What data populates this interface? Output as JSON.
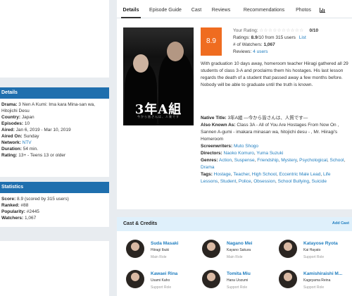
{
  "left": {
    "details": {
      "header": "Details",
      "rows": [
        {
          "label": "Drama:",
          "value": "3 Nen A Kumi: Ima kara Mina-san wa, Hitojichi Desu"
        },
        {
          "label": "Country:",
          "value": "Japan"
        },
        {
          "label": "Episodes:",
          "value": "10"
        },
        {
          "label": "Aired:",
          "value": "Jan 6, 2019 - Mar 10, 2019"
        },
        {
          "label": "Aired On:",
          "value": "Sunday"
        },
        {
          "label": "Network:",
          "value": "NTV"
        },
        {
          "label": "Duration:",
          "value": "54 min."
        },
        {
          "label": "Rating:",
          "value": "13+ - Teens 13 or older"
        }
      ]
    },
    "statistics": {
      "header": "Statistics",
      "rows": [
        {
          "label": "Score:",
          "value": "8.9 (scored by 315 users)"
        },
        {
          "label": "Ranked:",
          "value": "#88"
        },
        {
          "label": "Popularity:",
          "value": "#2445"
        },
        {
          "label": "Watchers:",
          "value": "1,067"
        }
      ]
    }
  },
  "tabs": [
    "Details",
    "Episode Guide",
    "Cast",
    "Reviews",
    "Recommendations",
    "Photos"
  ],
  "poster": {
    "title": "3年A組",
    "subtitle": "今から皆さんは、人質です"
  },
  "score_badge": "8.9",
  "rating": {
    "your_rating_label": "Your Rating:",
    "your_rating_value": "0/10",
    "ratings_label": "Ratings:",
    "ratings_value": "8.9",
    "ratings_suffix": "/10 from 315 users",
    "list_link": "List",
    "watchers_label": "# of Watchers:",
    "watchers_value": "1,067",
    "reviews_label": "Reviews:",
    "reviews_value": "4 users"
  },
  "synopsis": "With graduation 10 days away, homeroom teacher Hiiragi gathered all 29 students of class 3-A and proclaims them his hostages. His last lesson regards the death of a student that passed away a few months before. Nobody will be able to graduate until the truth is known.",
  "info": {
    "native_label": "Native Title:",
    "native_value": "3年A組 ―今から皆さんは、人質です―",
    "aka_label": "Also Known As:",
    "aka_value": "Class 3A - All of You Are Hostages From Now On , Sannen A-gumi - imakara minasan wa, hitojichi desu - , Mr. Hiiragi's Homeroom",
    "screenwriters_label": "Screenwriters:",
    "screenwriters": [
      "Muto Shogo"
    ],
    "directors_label": "Directors:",
    "directors": [
      "Naoko Komuro",
      "Yuma Suzuki"
    ],
    "genres_label": "Genres:",
    "genres": [
      "Action",
      "Suspense",
      "Friendship",
      "Mystery",
      "Psychological",
      "School",
      "Drama"
    ],
    "tags_label": "Tags:",
    "tags": [
      "Hostage",
      "Teacher",
      "High School",
      "Eccentric Male Lead",
      "Life Lessons",
      "Student",
      "Police",
      "Obsession",
      "School Bullying",
      "Suicide"
    ]
  },
  "cast": {
    "header": "Cast & Credits",
    "add_label": "Add Cast",
    "members": [
      {
        "name": "Suda Masaki",
        "character": "Hiiragi Ibuki",
        "role": "Main Role"
      },
      {
        "name": "Nagano Mei",
        "character": "Kayano Sakura",
        "role": "Main Role"
      },
      {
        "name": "Katayose Ryota",
        "character": "Kai Hayato",
        "role": "Support Role"
      },
      {
        "name": "Kawaei Rina",
        "character": "Usami Kaho",
        "role": "Support Role"
      },
      {
        "name": "Tomita Miu",
        "character": "Hana Uozumi",
        "role": "Support Role"
      },
      {
        "name": "Kamishiraishi M...",
        "character": "Kageyama Reina",
        "role": "Support Role"
      }
    ]
  },
  "colors": {
    "accent": "#1f6fae",
    "link": "#1f7dbf",
    "score": "#ef6c20"
  }
}
